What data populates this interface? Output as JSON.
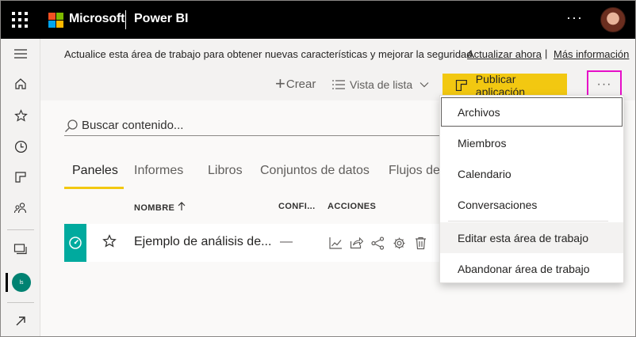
{
  "topbar": {
    "brand": "Microsoft",
    "product": "Power BI",
    "more_label": "···",
    "logo_colors": [
      "#f25022",
      "#7fba00",
      "#00a4ef",
      "#ffb900"
    ]
  },
  "leftnav": {
    "items": [
      {
        "icon": "hamburger-icon"
      },
      {
        "icon": "home-icon"
      },
      {
        "icon": "star-icon"
      },
      {
        "icon": "clock-icon"
      },
      {
        "icon": "apps-icon"
      },
      {
        "icon": "shared-people-icon"
      },
      {
        "icon": "workspaces-icon"
      },
      {
        "icon": "expand-arrow-icon"
      }
    ],
    "workspace_initials": "ls"
  },
  "banner": {
    "text": "Actualice esta área de trabajo para obtener nuevas características y mejorar la seguridad.",
    "update_link": "Actualizar ahora",
    "separator": "|",
    "more_info_link": "Más información"
  },
  "toolbar": {
    "create_label": "Crear",
    "view_label": "Vista de lista",
    "publish_label": "Publicar aplicación",
    "more_label": "···",
    "accent": "#f2c811",
    "highlight": "#e60ec8"
  },
  "search": {
    "placeholder": "Buscar contenido..."
  },
  "tabs": [
    {
      "label": "Paneles",
      "active": true
    },
    {
      "label": "Informes",
      "active": false
    },
    {
      "label": "Libros",
      "active": false
    },
    {
      "label": "Conjuntos de datos",
      "active": false
    },
    {
      "label": "Flujos de",
      "active": false
    }
  ],
  "table": {
    "headers": {
      "name": "NOMBRE",
      "sort_icon": "arrow-up-icon",
      "confidential": "CONFI...",
      "actions": "ACCIONES"
    },
    "rows": [
      {
        "name": "Ejemplo de análisis de...",
        "confidential": "—",
        "tile_color": "#00aa9e",
        "action_icons": [
          "analytics-icon",
          "share-icon",
          "connection-icon",
          "settings-icon",
          "delete-icon"
        ]
      }
    ]
  },
  "dropdown": {
    "items": [
      {
        "label": "Archivos",
        "state": "focused"
      },
      {
        "label": "Miembros",
        "state": "normal"
      },
      {
        "label": "Calendario",
        "state": "normal"
      },
      {
        "label": "Conversaciones",
        "state": "normal"
      },
      {
        "label": "Editar esta área de trabajo",
        "state": "hovered"
      },
      {
        "label": "Abandonar área de trabajo",
        "state": "normal"
      }
    ]
  }
}
